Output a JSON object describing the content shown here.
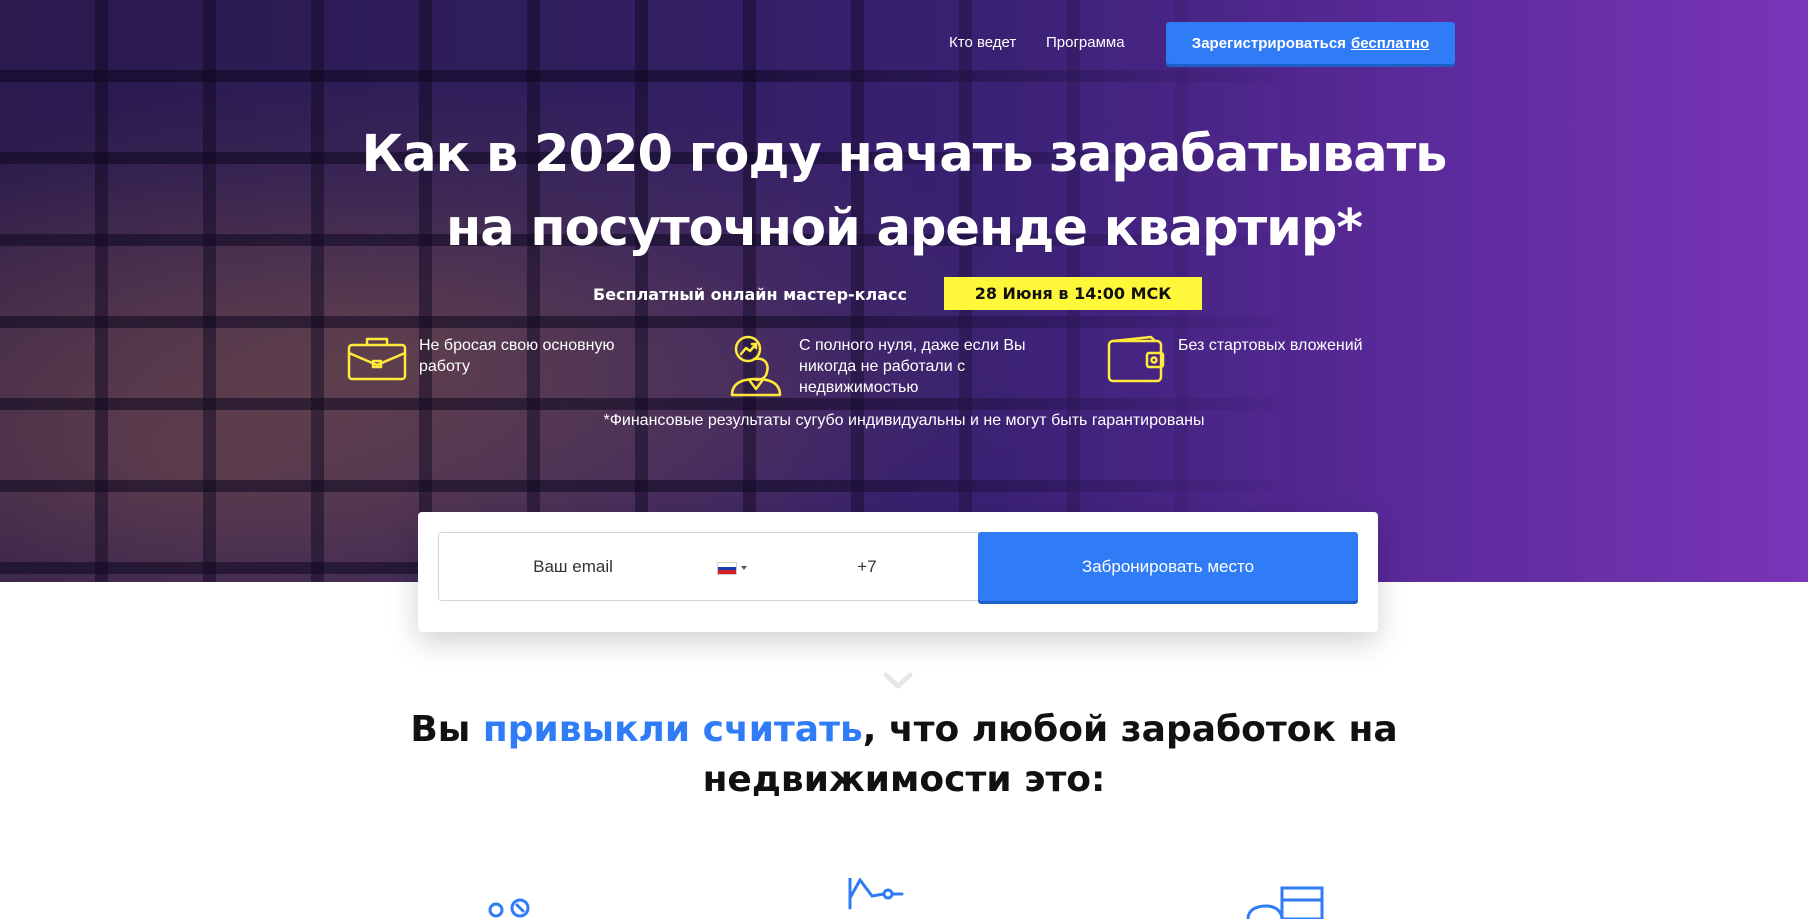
{
  "nav": {
    "links": [
      "Кто ведет",
      "Программа"
    ],
    "register_prefix": "Зарегистрироваться",
    "register_suffix": "бесплатно"
  },
  "hero": {
    "title_line1": "Как в 2020 году начать зарабатывать",
    "title_line2": "на посуточной аренде квартир*",
    "subtitle": "Бесплатный онлайн мастер-класс",
    "date_badge": "28 Июня в 14:00 МСК",
    "features": [
      {
        "icon": "briefcase-icon",
        "text": "Не бросая свою основную работу"
      },
      {
        "icon": "person-chart-icon",
        "text": "С полного нуля, даже если Вы никогда не работали с недвижимостью"
      },
      {
        "icon": "wallet-icon",
        "text": "Без стартовых вложений"
      }
    ],
    "disclaimer": "*Финансовые результаты сугубо индивидуальны и не могут быть гарантированы"
  },
  "form": {
    "email_placeholder": "Ваш email",
    "phone_value": "+7",
    "country_flag": "ru-flag-icon",
    "submit_label": "Забронировать место"
  },
  "section": {
    "title_part1": "Вы ",
    "title_highlight": "привыкли считать",
    "title_part2": ", что любой заработок на",
    "title_line2": "недвижимости это:"
  },
  "colors": {
    "accent": "#2f7cf6",
    "badge": "#fff73a",
    "icon_yellow": "#ffe93a",
    "hero_purple": "#7a35b8"
  }
}
